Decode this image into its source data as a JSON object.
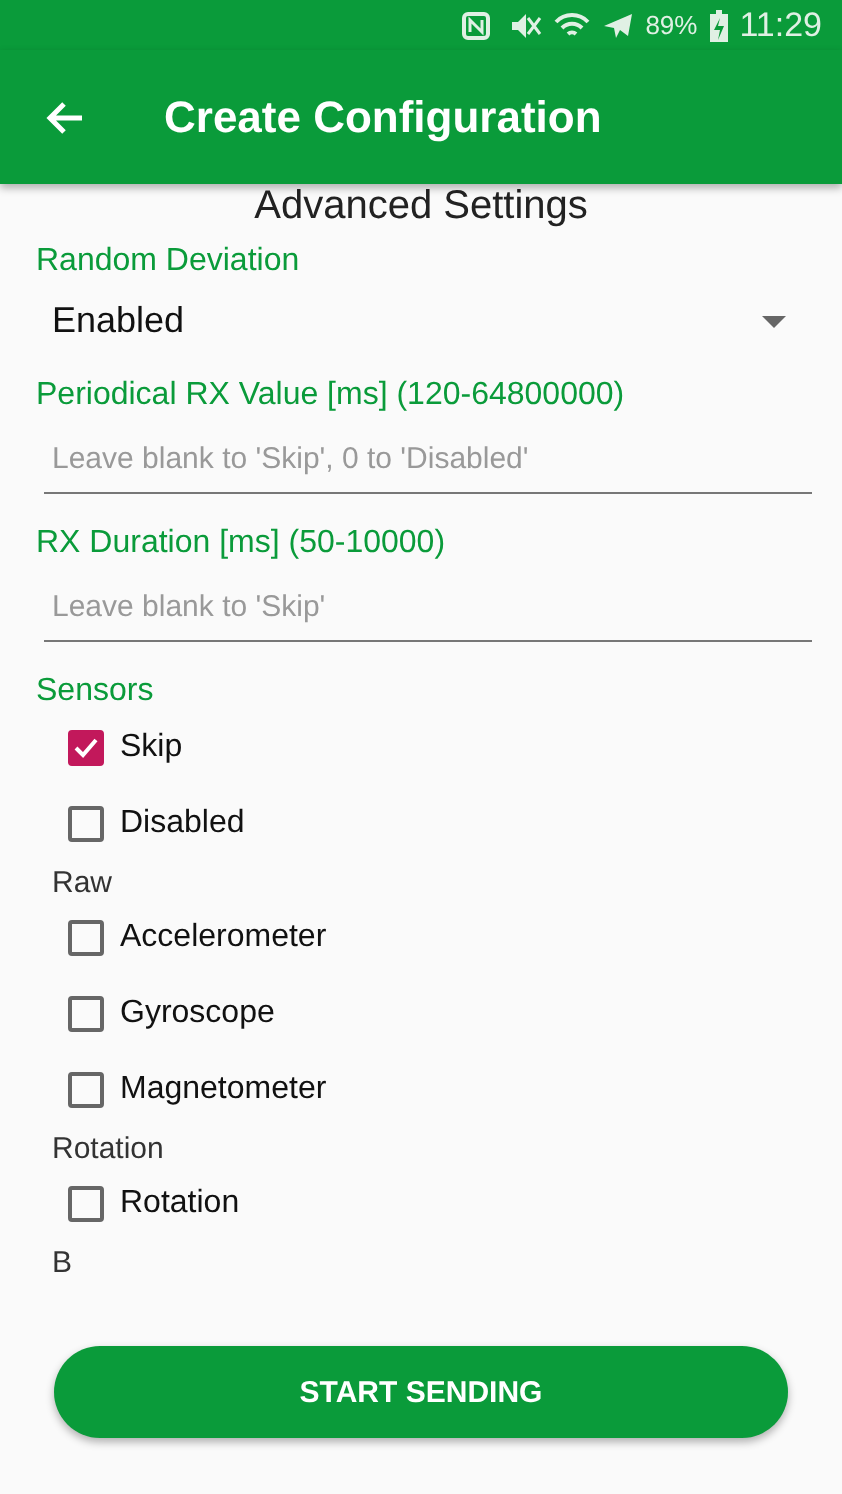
{
  "status_bar": {
    "battery": "89%",
    "time": "11:29"
  },
  "app_bar": {
    "title": "Create Configuration"
  },
  "section_title": "Advanced Settings",
  "random_deviation": {
    "label": "Random Deviation",
    "value": "Enabled"
  },
  "fields": [
    {
      "label": "Periodical RX Value [ms] (120-64800000)",
      "placeholder": "Leave blank to 'Skip', 0 to 'Disabled'"
    },
    {
      "label": "RX Duration [ms] (50-10000)",
      "placeholder": "Leave blank to 'Skip'"
    }
  ],
  "sensors": {
    "label": "Sensors",
    "items": [
      {
        "kind": "checkbox",
        "label": "Skip",
        "checked": true
      },
      {
        "kind": "checkbox",
        "label": "Disabled",
        "checked": false
      },
      {
        "kind": "heading",
        "label": "Raw"
      },
      {
        "kind": "checkbox",
        "label": "Accelerometer",
        "checked": false
      },
      {
        "kind": "checkbox",
        "label": "Gyroscope",
        "checked": false
      },
      {
        "kind": "checkbox",
        "label": "Magnetometer",
        "checked": false
      },
      {
        "kind": "heading",
        "label": "Rotation"
      },
      {
        "kind": "checkbox",
        "label": "Rotation",
        "checked": false
      },
      {
        "kind": "heading",
        "label": "B"
      }
    ]
  },
  "primary_button": "START SENDING"
}
